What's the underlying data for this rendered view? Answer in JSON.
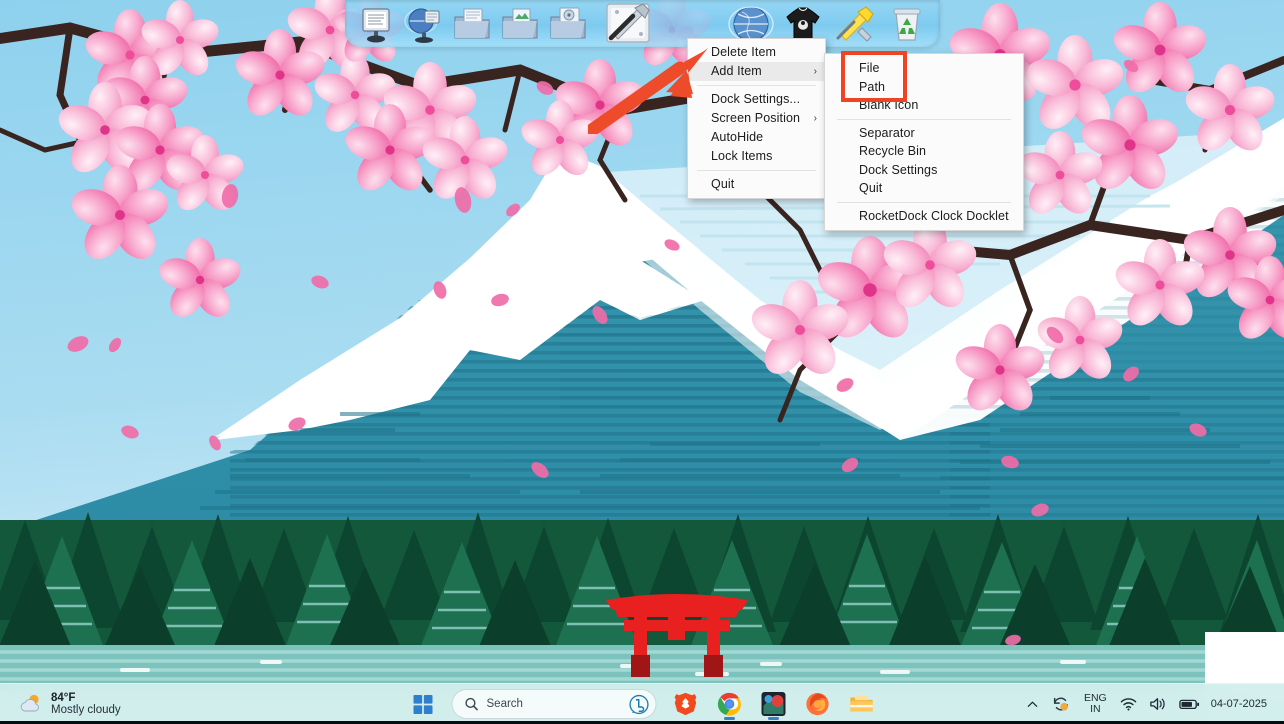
{
  "desktop": {
    "wallpaper_name": "cherry-blossom-mount-fuji-torii",
    "colors": {
      "sky_top": "#8fd2ee",
      "sky_bottom": "#cfeaf6",
      "mountain": "#2f8fa8",
      "mountain_dark": "#1d6f86",
      "snow": "#ffffff",
      "forest_dark": "#0f4a32",
      "forest_mid": "#1c6b47",
      "water": "#7fc3bd",
      "torii_red": "#e8201f",
      "blossom_pink": "#f06ca8",
      "blossom_light": "#f9b7d2",
      "branch": "#3a2420"
    }
  },
  "dock": {
    "name": "RocketDock",
    "left_icons": [
      {
        "name": "notepad-document-icon",
        "label": "Notepad"
      },
      {
        "name": "internet-globe-shortcut-icon",
        "label": "Internet"
      },
      {
        "name": "documents-folder-icon",
        "label": "Documents"
      },
      {
        "name": "pictures-folder-icon",
        "label": "Pictures"
      },
      {
        "name": "music-folder-icon",
        "label": "Music"
      },
      {
        "name": "tools-hammer-wrench-icon",
        "label": "Tools"
      }
    ],
    "right_icons": [
      {
        "name": "globe-browser-icon",
        "label": "Browser"
      },
      {
        "name": "tshirt-icon",
        "label": "Skins"
      },
      {
        "name": "hammer-wrench-icon",
        "label": "Settings"
      },
      {
        "name": "recycle-bin-icon",
        "label": "Recycle Bin"
      }
    ]
  },
  "context_menu": {
    "items": [
      {
        "label": "Delete Item",
        "submenu": false,
        "selected": false
      },
      {
        "label": "Add Item",
        "submenu": true,
        "selected": true
      },
      {
        "separator": true
      },
      {
        "label": "Dock Settings...",
        "submenu": false,
        "selected": false
      },
      {
        "label": "Screen Position",
        "submenu": true,
        "selected": false
      },
      {
        "label": "AutoHide",
        "submenu": false,
        "selected": false
      },
      {
        "label": "Lock Items",
        "submenu": false,
        "selected": false
      },
      {
        "separator": true
      },
      {
        "label": "Quit",
        "submenu": false,
        "selected": false
      }
    ],
    "labels": {
      "delete_item": "Delete Item",
      "add_item": "Add Item",
      "dock_settings": "Dock Settings...",
      "screen_position": "Screen Position",
      "autohide": "AutoHide",
      "lock_items": "Lock Items",
      "quit": "Quit"
    },
    "submenu_arrow": "›"
  },
  "add_item_submenu": {
    "labels": {
      "file": "File",
      "path": "Path",
      "blank_icon": "Blank Icon",
      "separator_item": "Separator",
      "recycle_bin": "Recycle Bin",
      "dock_settings": "Dock Settings",
      "quit": "Quit",
      "clock_docklet": "RocketDock Clock Docklet"
    }
  },
  "annotations": {
    "highlight_color": "#ef4323",
    "arrow_color": "#ee4b2b",
    "highlight_target": "File and Path submenu entries",
    "arrow_target": "Add Item menu entry"
  },
  "taskbar": {
    "weather": {
      "temperature": "84°F",
      "condition": "Mostly cloudy",
      "icon": "partly-cloudy-sun-icon"
    },
    "start_button": "start-button",
    "search": {
      "placeholder": "Search",
      "icon": "search-icon",
      "copilot_icon": "bing-copilot-icon"
    },
    "apps": [
      {
        "name": "brave-browser-icon",
        "label": "Brave",
        "running": false
      },
      {
        "name": "google-chrome-icon",
        "label": "Google Chrome",
        "running": true
      },
      {
        "name": "app-tile-icon",
        "label": "App",
        "running": true
      },
      {
        "name": "firefox-icon",
        "label": "Mozilla Firefox",
        "running": false
      },
      {
        "name": "file-explorer-icon",
        "label": "File Explorer",
        "running": false
      }
    ],
    "tray": {
      "overflow_icon": "chevron-up-icon",
      "sync_icon": "onedrive-sync-icon",
      "language_top": "ENG",
      "language_bottom": "IN",
      "wifi_icon": "wifi-icon",
      "volume_icon": "speaker-icon",
      "battery_icon": "battery-icon",
      "date": "04-07-2025",
      "time": ""
    }
  }
}
